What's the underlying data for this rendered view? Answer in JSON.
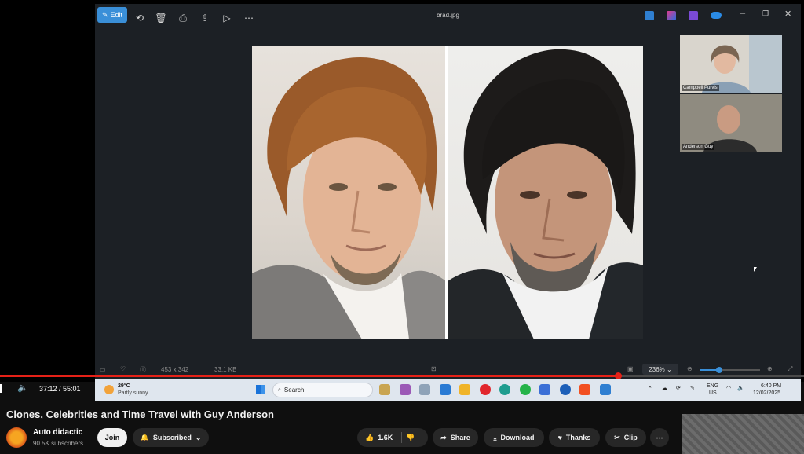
{
  "viewer": {
    "edit_label": "Edit",
    "filename": "brad.jpg",
    "dims": "453 x 342",
    "size": "33.1 KB",
    "zoom": "236%"
  },
  "participants": [
    {
      "name": "Campbell Purvis"
    },
    {
      "name": "Anderson Guy"
    }
  ],
  "player": {
    "time": "37:12 / 55:01",
    "progress_fraction": 0.769
  },
  "taskbar": {
    "temp": "29°C",
    "weather": "Partly sunny",
    "search_placeholder": "Search",
    "lang1": "ENG",
    "lang2": "US",
    "time": "6:40 PM",
    "date": "12/02/2025"
  },
  "video": {
    "title": "Clones, Celebrities and Time Travel with Guy Anderson",
    "channel": "Auto didactic",
    "subscribers": "90.5K subscribers",
    "join_label": "Join",
    "subscribed_label": "Subscribed",
    "likes": "1.6K",
    "share_label": "Share",
    "download_label": "Download",
    "thanks_label": "Thanks",
    "clip_label": "Clip"
  },
  "colors": {
    "accent": "#e62117",
    "edit": "#3a8fd8"
  },
  "icons": [
    "rotate-icon",
    "delete-icon",
    "print-icon",
    "share-icon",
    "slideshow-icon",
    "more-icon",
    "like-icon",
    "dislike-icon",
    "download-icon",
    "scissors-icon"
  ]
}
